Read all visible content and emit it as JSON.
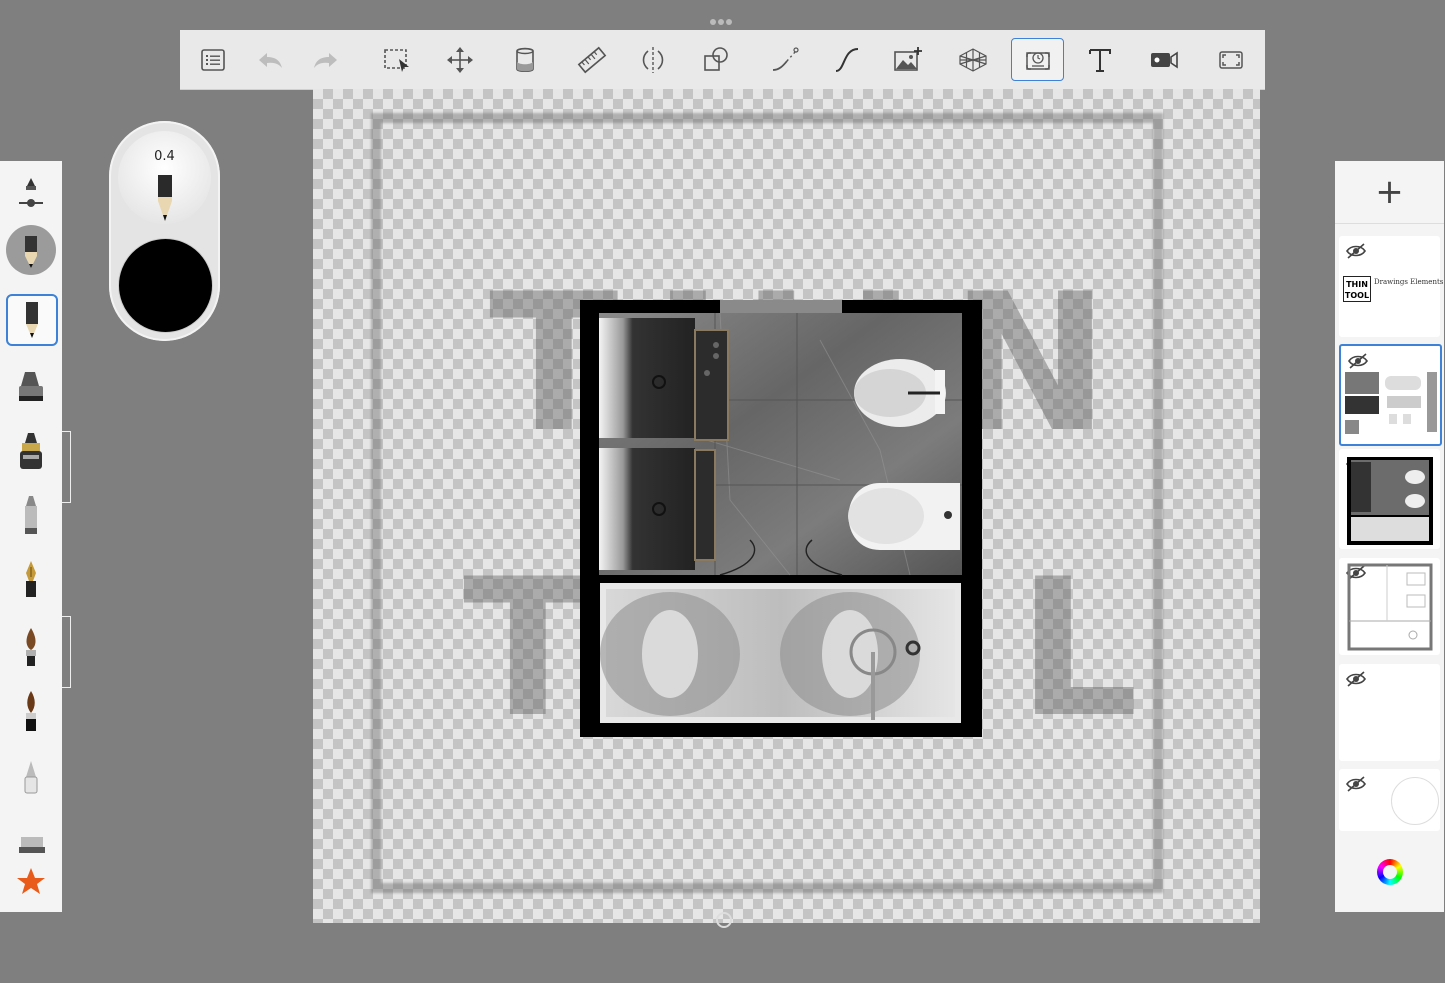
{
  "brush": {
    "size_value": "0.4",
    "color": "#000000"
  },
  "toolbar": {
    "tools": [
      "list-icon",
      "undo-icon",
      "redo-icon",
      "selection-icon",
      "transform-icon",
      "fill-icon",
      "ruler-icon",
      "symmetry-icon",
      "shapes-icon",
      "stroke-icon",
      "curve-icon",
      "add-image-icon",
      "perspective-icon",
      "time-lapse-icon",
      "text-icon",
      "video-icon",
      "fullscreen-icon"
    ],
    "selected": "time-lapse-icon"
  },
  "canvas": {
    "watermark_line1": "THIN",
    "watermark_line2": "TOOL"
  },
  "layers": {
    "add_label": "+",
    "items": [
      {
        "name": "text-layer",
        "visible": false,
        "logo_line1": "THIN",
        "logo_line2": "TOOL",
        "caption": "Drawings Elements"
      },
      {
        "name": "elements-layer",
        "visible": false,
        "selected": true
      },
      {
        "name": "bathroom-plan-layer",
        "visible": true
      },
      {
        "name": "sketch-layer",
        "visible": false
      },
      {
        "name": "blank-layer",
        "visible": false
      },
      {
        "name": "background-layer",
        "visible": false
      }
    ]
  },
  "colors": {
    "accent": "#3d82d6",
    "workspace": "#7f7f7f",
    "panel": "#f4f4f4"
  }
}
